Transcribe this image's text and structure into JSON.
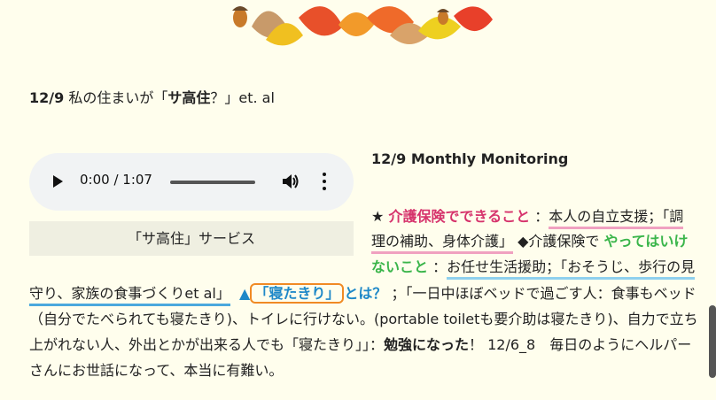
{
  "post_title": {
    "date": "12/9",
    "text_before": " 私の住まいが「",
    "bold": "サ高住",
    "text_after": "？」et. al"
  },
  "audio_player": {
    "time": "0:00 / 1:07",
    "progress": 0
  },
  "caption": "「サ高住」サービス",
  "monthly_title": "12/9 Monthly Monitoring",
  "body": {
    "star": "★",
    "kaigo_can": "介護保険でできること",
    "colon1": "：",
    "can_text_1": "本人の自立支援；「調",
    "can_text_2": "理の補助、身体介護」",
    "diamond": "◆介護保険で",
    "cannot_1": "やってはいけ",
    "cannot_2": "ないこと",
    "colon2": "：",
    "cannot_text_1": "お任せ生活援助；「おそうじ、歩行の見",
    "cannot_text_2": "守り、家族の食事づくりet al」",
    "triangle": "▲",
    "netakiri": "「寝たきり」",
    "towa": "とは？",
    "def_1": "；「一日中ほぼベッドで過ごす人：食事もベッド",
    "line5": "（自分でたべられても寝たきり)、トイレに行けない。(portable toiletも要介助は寝たきり)、自力で立ち",
    "line6_a": "上がれない人、外出とかが出来る人でも「寝たきり」」：",
    "line6_bold": "勉強になった",
    "line6_b": "！ 12/6_8　毎日のようにヘルパー",
    "line7": "さんにお世話になって、本当に有難い。"
  },
  "colors": {
    "background": "#fffeed",
    "pink": "#d6336c",
    "green": "#3ab54a",
    "blue": "#1e88c8",
    "orange_circle": "#f08a24"
  }
}
